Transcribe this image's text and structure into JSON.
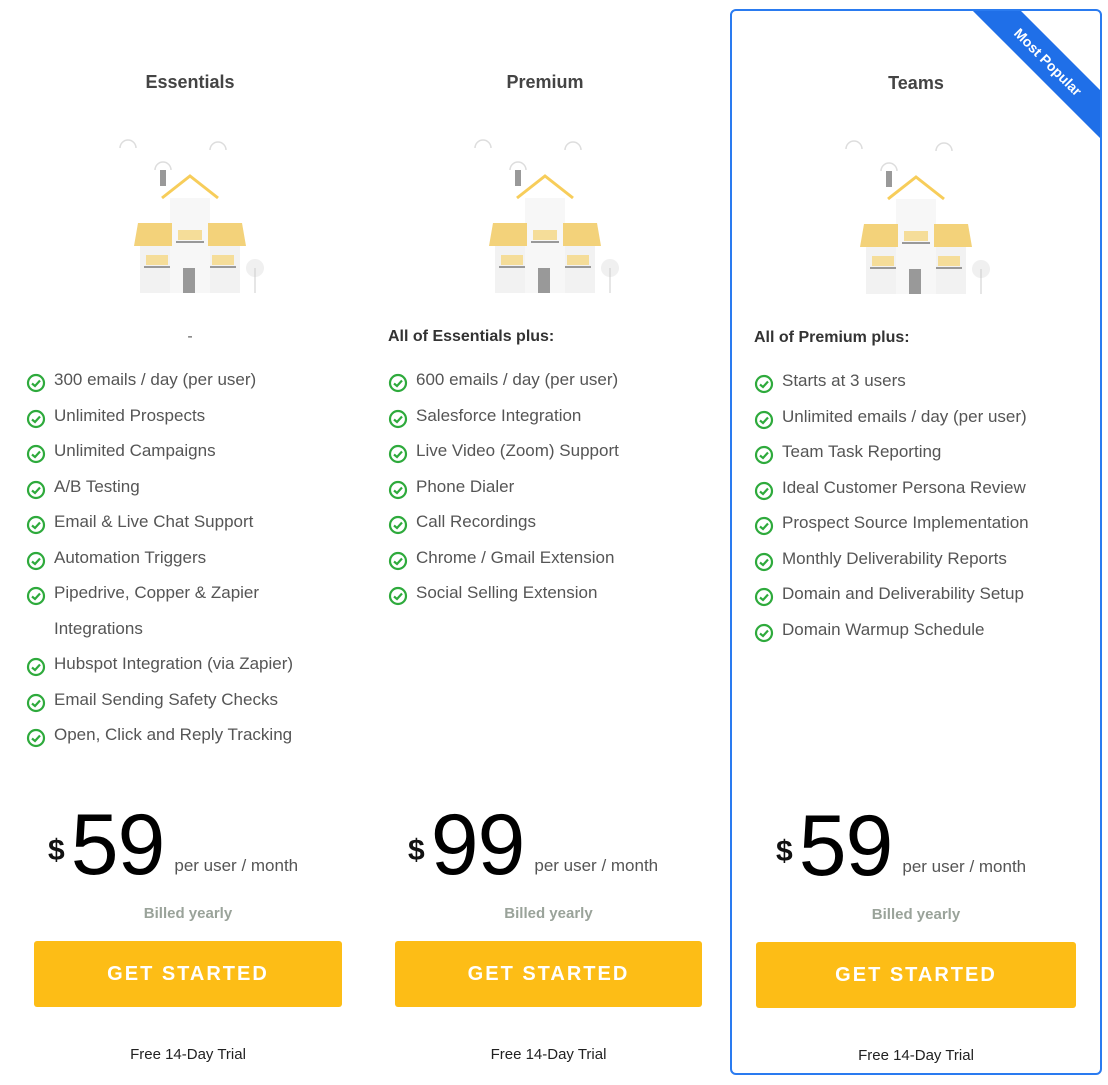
{
  "colors": {
    "accent": "#2a7bf0",
    "button": "#fdbd16",
    "check": "#2eaa3c"
  },
  "plans": [
    {
      "title": "Essentials",
      "heading": "-",
      "features": [
        "300 emails / day (per user)",
        "Unlimited Prospects",
        "Unlimited Campaigns",
        "A/B Testing",
        "Email & Live Chat Support",
        "Automation Triggers",
        "Pipedrive, Copper & Zapier Integrations",
        "Hubspot Integration (via Zapier)",
        "Email Sending Safety Checks",
        "Open, Click and Reply Tracking"
      ],
      "currency": "$",
      "amount": "59",
      "period": "per user / month",
      "billing": "Billed yearly",
      "cta": "GET STARTED",
      "trial": "Free 14-Day Trial"
    },
    {
      "title": "Premium",
      "heading": "All of Essentials plus:",
      "features": [
        "600 emails / day (per user)",
        "Salesforce Integration",
        "Live Video (Zoom) Support",
        "Phone Dialer",
        "Call Recordings",
        "Chrome / Gmail Extension",
        "Social Selling Extension"
      ],
      "currency": "$",
      "amount": "99",
      "period": "per user / month",
      "billing": "Billed yearly",
      "cta": "GET STARTED",
      "trial": "Free 14-Day Trial"
    },
    {
      "title": "Teams",
      "badge": "Most Popular",
      "heading": "All of Premium plus:",
      "features": [
        "Starts at 3 users",
        "Unlimited emails / day (per user)",
        "Team Task Reporting",
        "Ideal Customer Persona Review",
        "Prospect Source Implementation",
        "Monthly Deliverability Reports",
        "Domain and Deliverability Setup",
        "Domain Warmup Schedule"
      ],
      "currency": "$",
      "amount": "59",
      "period": "per user / month",
      "billing": "Billed yearly",
      "cta": "GET STARTED",
      "trial": "Free 14-Day Trial"
    }
  ]
}
